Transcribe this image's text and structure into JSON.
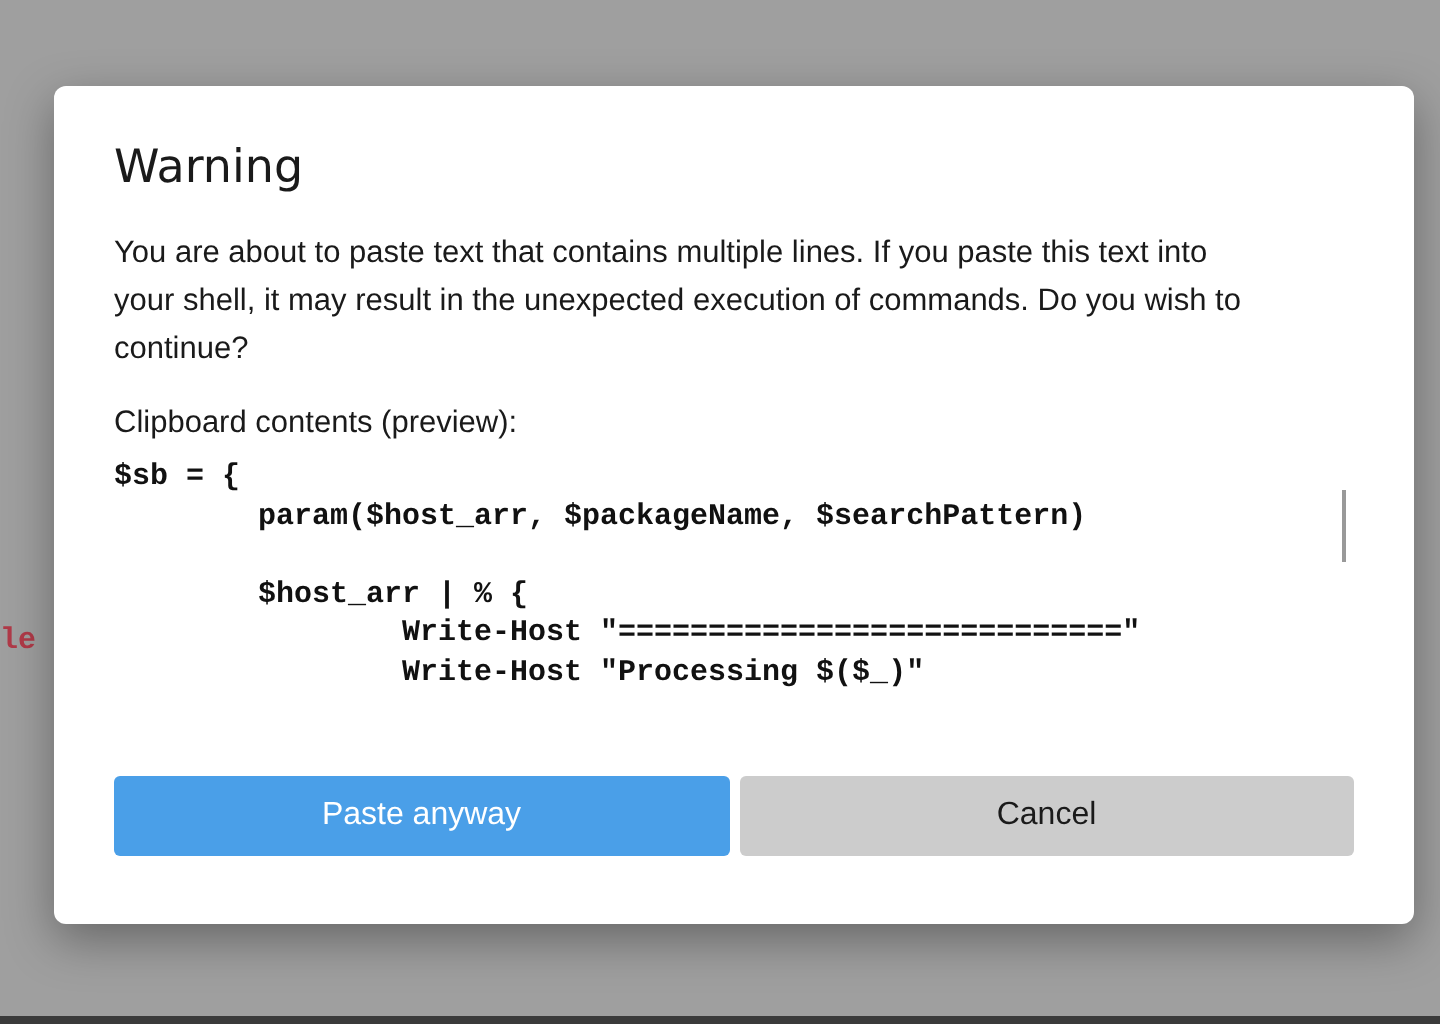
{
  "background_text": "le",
  "dialog": {
    "title": "Warning",
    "message": "You are about to paste text that contains multiple lines. If you paste this text into your shell, it may result in the unexpected execution of commands. Do you wish to continue?",
    "preview_label": "Clipboard contents (preview):",
    "preview_lines": [
      {
        "text": "$sb = {",
        "gap_before": false
      },
      {
        "text": "        param($host_arr, $packageName, $searchPattern)",
        "gap_before": false
      },
      {
        "text": "        $host_arr | % {",
        "gap_before": true
      },
      {
        "text": "                Write-Host \"============================\"",
        "gap_before": false
      },
      {
        "text": "                Write-Host \"Processing $($_)\"",
        "gap_before": false
      }
    ],
    "buttons": [
      {
        "label": "Paste anyway",
        "kind": "primary"
      },
      {
        "label": "Cancel",
        "kind": "secondary"
      }
    ]
  }
}
